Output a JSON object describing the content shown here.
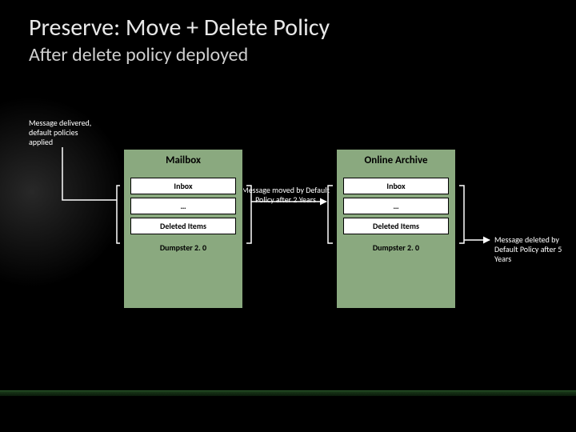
{
  "title": "Preserve: Move + Delete Policy",
  "subtitle": "After delete policy deployed",
  "notes": {
    "delivered": "Message delivered, default policies applied",
    "moved": "Message moved by Default Policy after 2 Years",
    "deleted": "Message deleted by Default Policy after 5 Years"
  },
  "mailbox": {
    "title": "Mailbox",
    "rows": [
      "Inbox",
      "…",
      "Deleted Items"
    ],
    "dumpster": "Dumpster 2. 0"
  },
  "archive": {
    "title": "Online Archive",
    "rows": [
      "Inbox",
      "…",
      "Deleted Items"
    ],
    "dumpster": "Dumpster 2. 0"
  }
}
